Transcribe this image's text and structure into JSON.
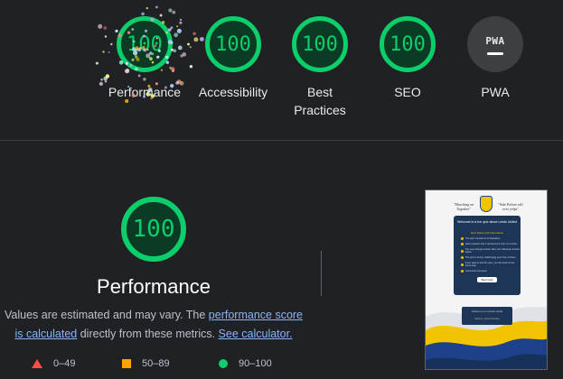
{
  "gauges": [
    {
      "score": "100",
      "label": "Performance"
    },
    {
      "score": "100",
      "label": "Accessibility"
    },
    {
      "score": "100",
      "label": "Best Practices"
    },
    {
      "score": "100",
      "label": "SEO"
    },
    {
      "badge": "PWA",
      "label": "PWA"
    }
  ],
  "performance": {
    "score": "100",
    "title": "Performance",
    "desc_prefix": "Values are estimated and may vary. The ",
    "desc_link1": "performance score is calculated",
    "desc_middle": " directly from these metrics. ",
    "desc_link2": "See calculator."
  },
  "legend": [
    {
      "range": "0–49",
      "color": "#ff4e42",
      "shape": "triangle"
    },
    {
      "range": "50–89",
      "color": "#ffa400",
      "shape": "square"
    },
    {
      "range": "90–100",
      "color": "#0cce6b",
      "shape": "circle"
    }
  ],
  "screenshot": {
    "quote_left": "\"Marching on Together\"",
    "quote_right": "\"Side Before self ever yelps\"",
    "welcome": "Welcome to a fun quiz about Leeds United",
    "rules_title": "Quiz Rules and Information",
    "rules": [
      "The quiz consists of 10 questions",
      "Each question has 4 answers but only 1 is correct",
      "You may change answer after you clicked an answer button",
      "The quiz is timed, challenging your time of focus",
      "If you want to end the quiz, you can click on the home logo",
      "Good luck everyone!"
    ],
    "start_label": "Start Quiz",
    "footer_text": "Follow us on social media",
    "footer_credit": "Made by leedsunitedfan"
  },
  "colors": {
    "good": "#0cce6b",
    "average": "#ffa400",
    "fail": "#ff4e42",
    "link": "#8ab4f8",
    "background": "#202124"
  }
}
